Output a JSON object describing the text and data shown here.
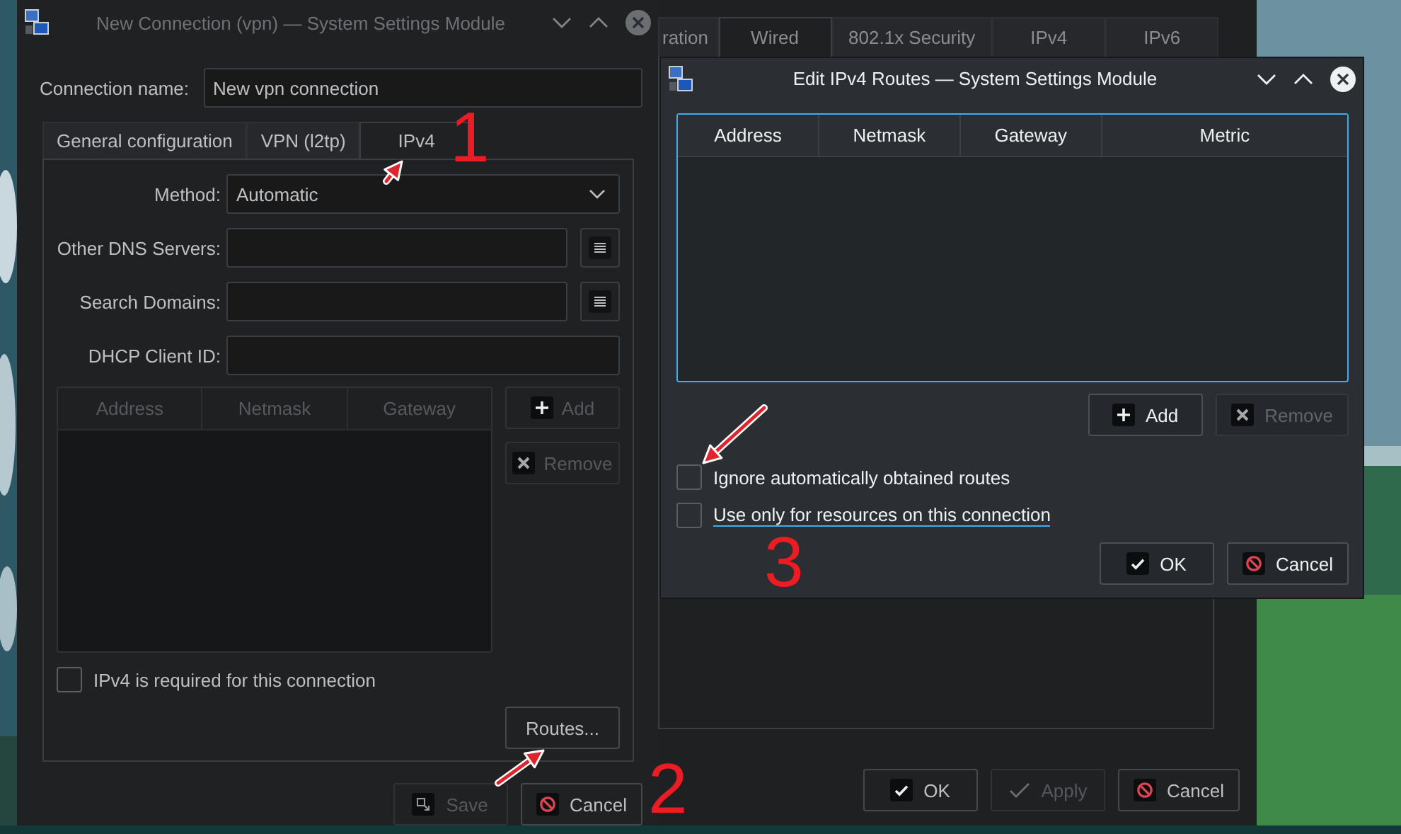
{
  "settings_window": {
    "tabs": [
      {
        "label": "ration",
        "selected": false
      },
      {
        "label": "Wired",
        "selected": true
      },
      {
        "label": "802.1x Security",
        "selected": false
      },
      {
        "label": "IPv4",
        "selected": false
      },
      {
        "label": "IPv6",
        "selected": false
      }
    ],
    "buttons": [
      {
        "kind": "ok",
        "label": "OK",
        "disabled": false
      },
      {
        "kind": "apply",
        "label": "Apply",
        "disabled": true
      },
      {
        "kind": "cancel",
        "label": "Cancel",
        "disabled": false
      }
    ]
  },
  "connection_dialog": {
    "title": "New Connection (vpn) — System Settings Module",
    "active": false,
    "name_label": "Connection name:",
    "name_value": "New vpn connection",
    "tabs": [
      {
        "label": "General configuration",
        "selected": false
      },
      {
        "label": "VPN (l2tp)",
        "selected": false
      },
      {
        "label": "IPv4",
        "selected": true
      }
    ],
    "fields": [
      {
        "kind": "combo",
        "label": "Method:",
        "value": "Automatic"
      },
      {
        "kind": "list",
        "label": "Other DNS Servers:"
      },
      {
        "kind": "list",
        "label": "Search Domains:"
      },
      {
        "kind": "text",
        "label": "DHCP Client ID:"
      }
    ],
    "table": {
      "disabled": true,
      "columns": [
        "Address",
        "Netmask",
        "Gateway"
      ]
    },
    "side_buttons": [
      {
        "kind": "add",
        "label": "Add",
        "disabled": true
      },
      {
        "kind": "remove",
        "label": "Remove",
        "disabled": true
      }
    ],
    "checkbox": {
      "label": "IPv4 is required for this connection",
      "checked": false
    },
    "routes_button": {
      "label": "Routes...",
      "disabled": false
    },
    "buttons": [
      {
        "kind": "save",
        "label": "Save",
        "disabled": true
      },
      {
        "kind": "cancel",
        "label": "Cancel",
        "disabled": false
      }
    ]
  },
  "routes_dialog": {
    "title": "Edit IPv4 Routes — System Settings Module",
    "active": true,
    "table": {
      "disabled": false,
      "columns": [
        "Address",
        "Netmask",
        "Gateway",
        "Metric"
      ]
    },
    "side_buttons": [
      {
        "kind": "add",
        "label": "Add",
        "disabled": false
      },
      {
        "kind": "remove",
        "label": "Remove",
        "disabled": true
      }
    ],
    "checkboxes": [
      {
        "label": "Ignore automatically obtained routes",
        "checked": false,
        "focused": false
      },
      {
        "label": "Use only for resources on this connection",
        "checked": false,
        "focused": true
      }
    ],
    "buttons": [
      {
        "kind": "ok",
        "label": "OK",
        "disabled": false
      },
      {
        "kind": "cancel",
        "label": "Cancel",
        "disabled": false
      }
    ]
  },
  "annotations": [
    {
      "label": "1"
    },
    {
      "label": "2"
    },
    {
      "label": "3"
    }
  ]
}
